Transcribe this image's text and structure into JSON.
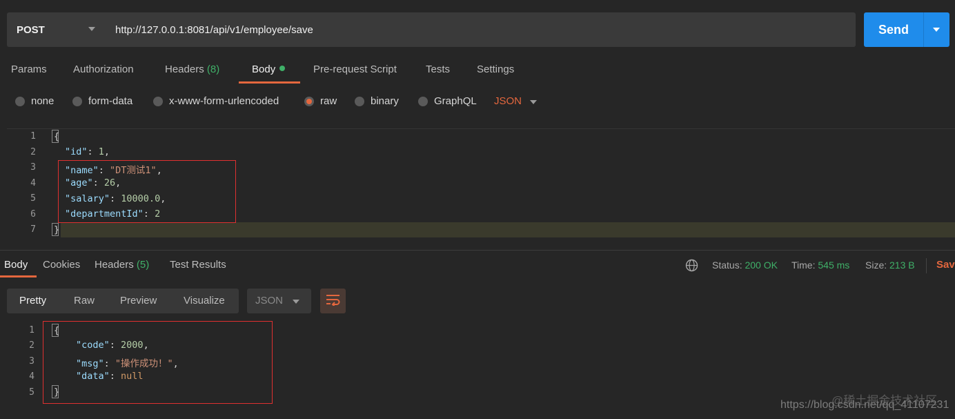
{
  "request": {
    "method": "POST",
    "url": "http://127.0.0.1:8081/api/v1/employee/save",
    "send_label": "Send"
  },
  "request_tabs": [
    {
      "label": "Params"
    },
    {
      "label": "Authorization"
    },
    {
      "label": "Headers",
      "count": "(8)"
    },
    {
      "label": "Body"
    },
    {
      "label": "Pre-request Script"
    },
    {
      "label": "Tests"
    },
    {
      "label": "Settings"
    }
  ],
  "body_types": [
    {
      "label": "none",
      "selected": false
    },
    {
      "label": "form-data",
      "selected": false
    },
    {
      "label": "x-www-form-urlencoded",
      "selected": false
    },
    {
      "label": "raw",
      "selected": true
    },
    {
      "label": "binary",
      "selected": false
    },
    {
      "label": "GraphQL",
      "selected": false
    }
  ],
  "raw_language": "JSON",
  "request_body": {
    "line_numbers": [
      "1",
      "2",
      "3",
      "4",
      "5",
      "6",
      "7"
    ],
    "open_brace": "{",
    "close_brace": "}",
    "fields": [
      {
        "key": "\"id\"",
        "value": "1",
        "sep": ",",
        "kind": "number"
      },
      {
        "key": "\"name\"",
        "value": "\"DT测试1\"",
        "sep": ",",
        "kind": "string"
      },
      {
        "key": "\"age\"",
        "value": "26",
        "sep": ",",
        "kind": "number"
      },
      {
        "key": "\"salary\"",
        "value": "10000.0",
        "sep": ",",
        "kind": "number"
      },
      {
        "key": "\"departmentId\"",
        "value": "2",
        "sep": "",
        "kind": "number"
      }
    ]
  },
  "response_tabs": [
    {
      "label": "Body"
    },
    {
      "label": "Cookies"
    },
    {
      "label": "Headers",
      "count": "(5)"
    },
    {
      "label": "Test Results"
    }
  ],
  "response_meta": {
    "status_label": "Status:",
    "status_value": "200 OK",
    "time_label": "Time:",
    "time_value": "545 ms",
    "size_label": "Size:",
    "size_value": "213 B",
    "save_label": "Save"
  },
  "view_modes": [
    "Pretty",
    "Raw",
    "Preview",
    "Visualize"
  ],
  "response_language": "JSON",
  "response_body": {
    "line_numbers": [
      "1",
      "2",
      "3",
      "4",
      "5"
    ],
    "open_brace": "{",
    "close_brace": "}",
    "fields": [
      {
        "key": "\"code\"",
        "value": "2000",
        "sep": ",",
        "kind": "number"
      },
      {
        "key": "\"msg\"",
        "value": "\"操作成功！\"",
        "sep": ",",
        "kind": "string"
      },
      {
        "key": "\"data\"",
        "value": "null",
        "sep": "",
        "kind": "null"
      }
    ]
  },
  "watermark": {
    "line1": "@稀土掘金技术社区",
    "line2": "https://blog.csdn.net/qq_41107231"
  },
  "colors": {
    "accent": "#e4673e",
    "send": "#1f8ceb",
    "status_green": "#3fb068",
    "highlight_box": "#e03030"
  }
}
